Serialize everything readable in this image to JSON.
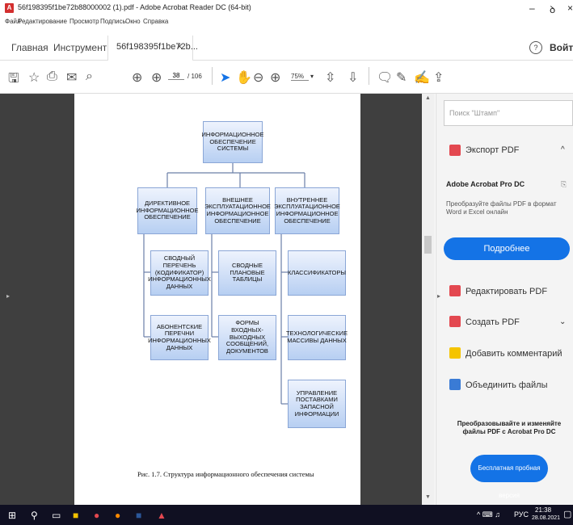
{
  "window": {
    "title": "56f198395f1be72b88000002 (1).pdf - Adobe Acrobat Reader DC (64-bit)",
    "minimize": "–",
    "maximize": "ꝺ",
    "close": "×"
  },
  "menu": [
    "Файл",
    "Редактирование",
    "Просмотр",
    "Подпись",
    "Окно",
    "Справка"
  ],
  "tabs": {
    "home": "Главная",
    "tools": "Инструменты",
    "document": "56f198395f1be72b...",
    "close": "×"
  },
  "header_right": {
    "help": "?",
    "login": "Войти"
  },
  "toolbar": {
    "page_current": "38",
    "page_total": "/ 106",
    "zoom": "75%",
    "zoom_caret": "▾"
  },
  "diagram": {
    "root": "Информационное обеспечение системы",
    "col1": "Директивное информационное обеспечение",
    "col2": "Внешнее эксплуатационное информационное обеспечение",
    "col3": "Внутреннее эксплуатационное информационное обеспечение",
    "c1a": "Сводный перечень (кодификатор) информационных данных",
    "c1b": "Абонентские перечни информационных данных",
    "c2a": "Сводные плановые таблицы",
    "c2b": "Формы входных-выходных сообщений, документов",
    "c3a": "Классификаторы",
    "c3b": "Технологические массивы данных",
    "c3c": "Управление поставками запасной информации",
    "caption": "Рис. 1.7. Структура информационного обеспечения системы"
  },
  "right_panel": {
    "search_placeholder": "Поиск \"Штамп\"",
    "export_pdf": "Экспорт PDF",
    "promo_title": "Adobe Acrobat Pro DC",
    "promo_text": "Преобразуйте файлы PDF в формат Word и Excel онлайн",
    "more_button": "Подробнее",
    "edit_pdf": "Редактировать PDF",
    "create_pdf": "Создать PDF",
    "add_comment": "Добавить комментарий",
    "combine_files": "Объединить файлы",
    "bottom_promo": "Преобразовывайте и изменяйте файлы PDF с Acrobat Pro DC",
    "trial_button": "Бесплатная пробная версия"
  },
  "taskbar": {
    "lang": "РУС",
    "time": "21:38",
    "date": "28.08.2021"
  },
  "colors": {
    "accent": "#1473e6",
    "export_icon": "#e34850",
    "edit_icon": "#e34850",
    "comment_icon": "#f5c400",
    "combine_icon": "#3a7bd5"
  }
}
